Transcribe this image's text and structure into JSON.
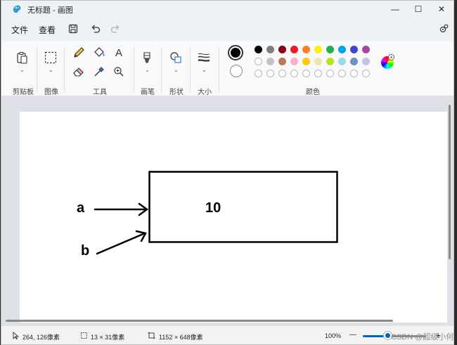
{
  "window": {
    "title": "无标题 - 画图",
    "minimize_glyph": "—",
    "maximize_glyph": "☐",
    "close_glyph": "✕"
  },
  "menu": {
    "file": "文件",
    "view": "查看"
  },
  "ribbon": {
    "groups": {
      "clipboard": "剪贴板",
      "image": "图像",
      "tools": "工具",
      "brushes": "画笔",
      "shapes": "形状",
      "size": "大小",
      "colors": "颜色"
    },
    "text_tool_glyph": "A"
  },
  "palette": {
    "active_color": "#000000",
    "secondary_color": "#ffffff",
    "row1": [
      "#000000",
      "#7f7f7f",
      "#880015",
      "#ed1c24",
      "#ff7f27",
      "#fff200",
      "#22b14c",
      "#00a2e8",
      "#3f48cc",
      "#a349a4"
    ],
    "row2": [
      "#ffffff",
      "#c3c3c3",
      "#b97a57",
      "#ffaec9",
      "#ffc90e",
      "#efe4b0",
      "#b5e61d",
      "#99d9ea",
      "#7092be",
      "#c8bfe7"
    ],
    "row3_empty_count": 10
  },
  "drawing": {
    "box_value": "10",
    "label_a": "a",
    "label_b": "b"
  },
  "status": {
    "cursor_position": "264, 126像素",
    "selection_size": "13 × 31像素",
    "canvas_size": "1152 × 648像素",
    "zoom": "100%",
    "zoom_out_glyph": "—",
    "zoom_in_glyph": "+"
  },
  "watermark": "CSDN @超级小何"
}
